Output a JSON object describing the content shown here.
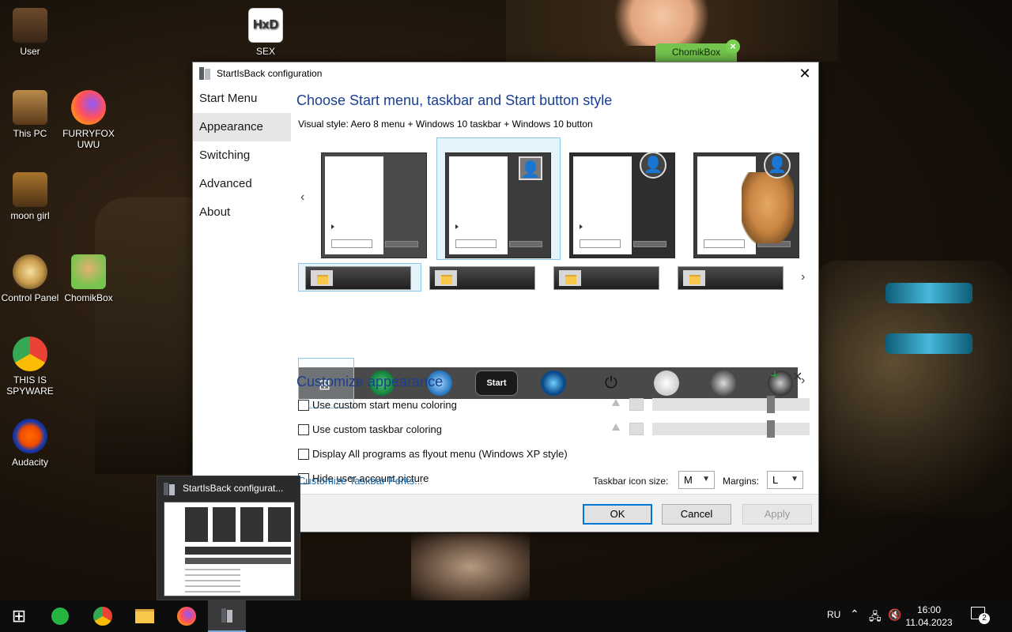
{
  "desktop": {
    "icons": [
      {
        "label": "User"
      },
      {
        "label": "SEX"
      },
      {
        "label": "This PC"
      },
      {
        "label": "FURRYFOX UWU"
      },
      {
        "label": "moon girl"
      },
      {
        "label": "Control Panel"
      },
      {
        "label": "ChomikBox"
      },
      {
        "label": "THIS IS SPYWARE"
      },
      {
        "label": "Audacity"
      }
    ],
    "badge": {
      "label": "ChomikBox",
      "close": "×"
    }
  },
  "window": {
    "title": "StartIsBack configuration",
    "close_glyph": "✕",
    "nav": [
      {
        "label": "Start Menu"
      },
      {
        "label": "Appearance"
      },
      {
        "label": "Switching"
      },
      {
        "label": "Advanced"
      },
      {
        "label": "About"
      }
    ],
    "heading": "Choose Start menu, taskbar and Start button style",
    "visual_style": "Visual style:  Aero 8 menu + Windows 10 taskbar + Windows 10 button",
    "start_button_label": "Start",
    "customize_heading": "Customize appearance",
    "add_glyph": "+",
    "remove_glyph": "✕",
    "options": [
      {
        "label": "Use custom start menu coloring"
      },
      {
        "label": "Use custom taskbar coloring"
      },
      {
        "label": "Display All programs as flyout menu (Windows XP style)"
      },
      {
        "label": "Hide user account picture"
      }
    ],
    "perks_link": "Customize Taskbar Perks...",
    "icon_size_label": "Taskbar icon size:",
    "icon_size_value": "M",
    "margins_label": "Margins:",
    "margins_value": "L",
    "buttons": {
      "ok": "OK",
      "cancel": "Cancel",
      "apply": "Apply"
    }
  },
  "popup": {
    "title": "StartIsBack configurat..."
  },
  "taskbar": {
    "lang": "RU",
    "time": "16:00",
    "date": "11.04.2023",
    "notif_count": "2",
    "accent": "#0078d7"
  }
}
